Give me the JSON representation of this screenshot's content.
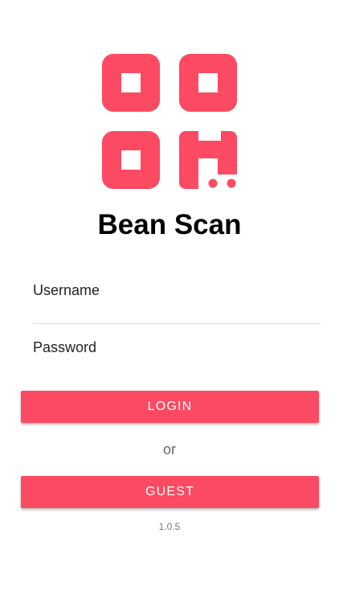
{
  "theme": {
    "accent_color": "#fc4a62"
  },
  "logo": {
    "icon": "qr-code-logo-icon"
  },
  "app": {
    "title": "Bean Scan"
  },
  "form": {
    "username_label": "Username",
    "password_label": "Password",
    "login_label": "LOGIN",
    "or_text": "or",
    "guest_label": "GUEST"
  },
  "footer": {
    "version": "1.0.5"
  }
}
